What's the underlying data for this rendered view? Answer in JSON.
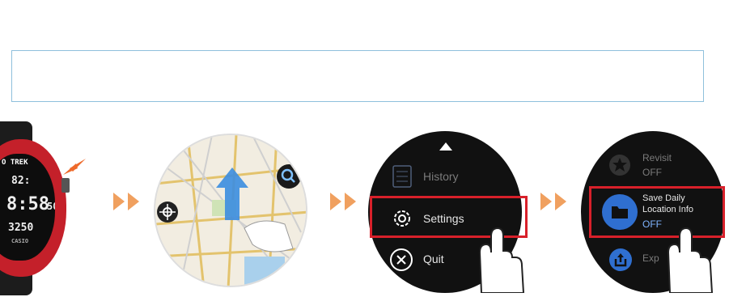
{
  "banner": {
    "text": ""
  },
  "watch": {
    "brand": "O TREK",
    "time": "8:58",
    "seconds": "50",
    "top_digits": "82:",
    "lower_digits": "3250",
    "maker": "CASIO"
  },
  "menu_screen": {
    "items": [
      {
        "label": "History",
        "state": "dim"
      },
      {
        "label": "Settings",
        "state": "highlighted"
      },
      {
        "label": "Quit",
        "state": "normal"
      }
    ]
  },
  "settings_screen": {
    "items": [
      {
        "label": "Revisit",
        "value": "OFF",
        "state": "dim"
      },
      {
        "label": "Save Daily\nLocation Info",
        "value": "OFF",
        "state": "highlighted"
      },
      {
        "label": "Exp",
        "value": "",
        "state": "dim"
      }
    ]
  },
  "colors": {
    "highlight": "#d8202a",
    "arrow": "#f0a05f",
    "frame": "#8fc0dc",
    "accent_blue": "#2f6fd0"
  }
}
